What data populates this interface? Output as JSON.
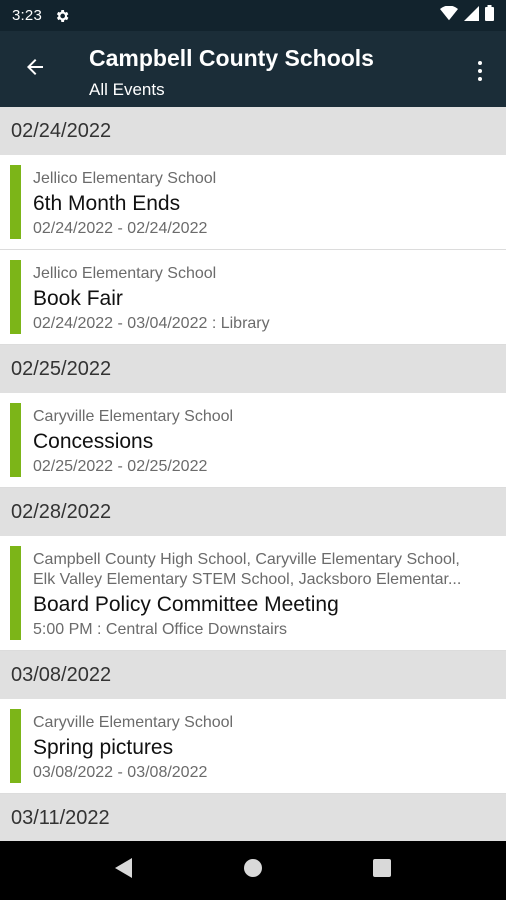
{
  "status_bar": {
    "time": "3:23",
    "icons": [
      "gear-icon",
      "wifi-icon",
      "signal-icon",
      "battery-icon"
    ]
  },
  "app_bar": {
    "title": "Campbell County Schools",
    "subtitle": "All Events",
    "back_icon": "arrow-left-icon",
    "menu_icon": "more-vert-icon"
  },
  "colors": {
    "status_bar_bg": "#12232d",
    "app_bar_bg": "#1b2d38",
    "accent_bar": "#7cb518",
    "date_header_bg": "#e0e0e0"
  },
  "groups": [
    {
      "date": "02/24/2022",
      "events": [
        {
          "school": "Jellico Elementary School",
          "title": "6th Month Ends",
          "details": "02/24/2022 - 02/24/2022"
        },
        {
          "school": "Jellico Elementary School",
          "title": "Book Fair",
          "details": "02/24/2022 - 03/04/2022 : Library"
        }
      ]
    },
    {
      "date": "02/25/2022",
      "events": [
        {
          "school": "Caryville Elementary School",
          "title": "Concessions",
          "details": "02/25/2022 - 02/25/2022"
        }
      ]
    },
    {
      "date": "02/28/2022",
      "events": [
        {
          "school_lines": [
            "Campbell County High School, Caryville Elementary School,",
            "Elk Valley Elementary STEM School, Jacksboro Elementar..."
          ],
          "title": "Board Policy Committee Meeting",
          "details": "5:00 PM : Central Office Downstairs"
        }
      ]
    },
    {
      "date": "03/08/2022",
      "events": [
        {
          "school": "Caryville Elementary School",
          "title": "Spring pictures",
          "details": "03/08/2022 - 03/08/2022"
        }
      ]
    },
    {
      "date": "03/11/2022",
      "events": []
    }
  ],
  "nav_bar": {
    "buttons": [
      "back-triangle-icon",
      "home-circle-icon",
      "recents-square-icon"
    ]
  }
}
